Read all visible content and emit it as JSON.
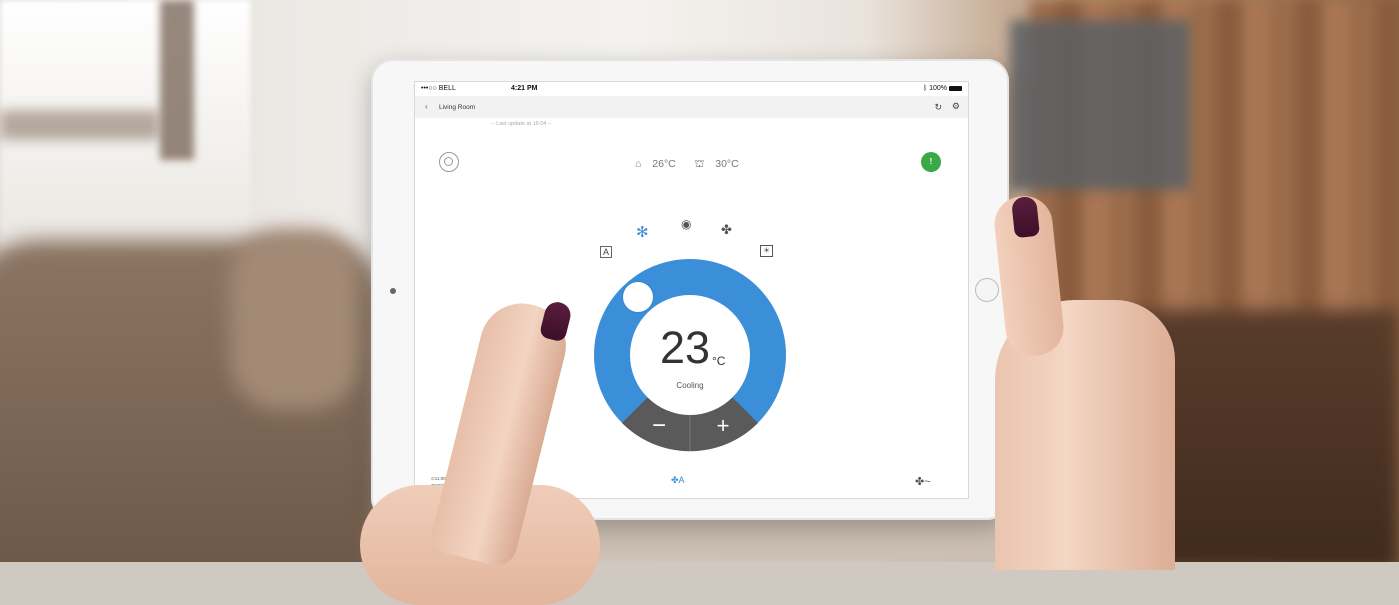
{
  "status_bar": {
    "carrier": "•••○○ BELL",
    "wifi_icon": "wifi-icon",
    "time": "4:21 PM",
    "bluetooth_icon": "bluetooth-icon",
    "battery": "100%"
  },
  "nav": {
    "back_icon": "chevron-left-icon",
    "title": "Living Room",
    "refresh_icon": "refresh-icon",
    "settings_icon": "gear-icon",
    "last_update": "-- Last update at 16:04 --"
  },
  "readings": {
    "indoor_temp": "26°C",
    "outdoor_temp": "30°C"
  },
  "status_indicator": {
    "color": "#3aa846"
  },
  "modes": {
    "items": [
      {
        "name": "auto",
        "glyph": "A"
      },
      {
        "name": "cool",
        "glyph": "✻"
      },
      {
        "name": "dry",
        "glyph": "◉"
      },
      {
        "name": "fan",
        "glyph": "✤"
      },
      {
        "name": "heat",
        "glyph": "☀"
      }
    ],
    "selected": "cool"
  },
  "thermostat": {
    "setpoint": "23",
    "unit": "°C",
    "mode_label": "Cooling",
    "decrease_label": "−",
    "increase_label": "+",
    "accent_color": "#3b8fd9",
    "control_color": "#5a5a5a"
  },
  "bottom_bar": {
    "timer_line1": "⊙11:00 Su",
    "timer_line2": "▣23°C",
    "fan_mode_glyph": "✤A",
    "swing_glyph": "✤~"
  }
}
